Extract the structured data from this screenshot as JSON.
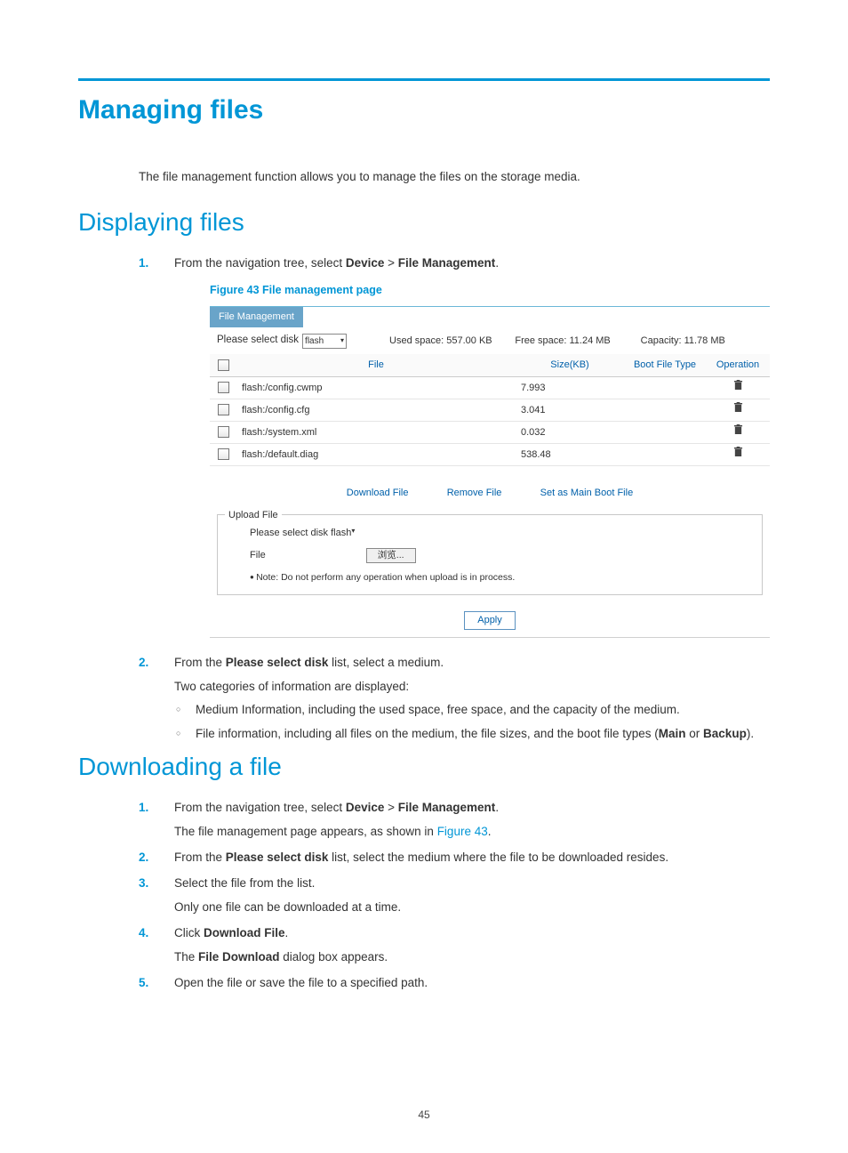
{
  "h1": "Managing files",
  "intro": "The file management function allows you to manage the files on the storage media.",
  "h2_display": "Displaying files",
  "h2_download": "Downloading a file",
  "figcap": "Figure 43 File management page",
  "nav_step": {
    "pre": "From the navigation tree, select ",
    "device": "Device",
    "gt": " > ",
    "fm": "File Management",
    "post": "."
  },
  "ss": {
    "tab": "File Management",
    "select_label": "Please select disk",
    "select_value": "flash",
    "used": "Used space: 557.00 KB",
    "free": "Free space: 11.24 MB",
    "cap": "Capacity: 11.78 MB",
    "cols": {
      "file": "File",
      "size": "Size(KB)",
      "boot": "Boot File Type",
      "op": "Operation"
    },
    "rows": [
      {
        "name": "flash:/config.cwmp",
        "size": "7.993"
      },
      {
        "name": "flash:/config.cfg",
        "size": "3.041"
      },
      {
        "name": "flash:/system.xml",
        "size": "0.032"
      },
      {
        "name": "flash:/default.diag",
        "size": "538.48"
      }
    ],
    "actions": {
      "download": "Download File",
      "remove": "Remove File",
      "setmain": "Set as Main Boot File"
    },
    "upload": {
      "legend": "Upload File",
      "select_label": "Please select disk",
      "select_value": "flash",
      "file_label": "File",
      "browse": "浏览...",
      "note": "Note: Do not perform any operation when upload is in process."
    },
    "apply": "Apply"
  },
  "disp_step2": {
    "pre": "From the ",
    "b": "Please select disk",
    "post": " list, select a medium.",
    "sub": "Two categories of information are displayed:",
    "b1": "Medium Information, including the used space, free space, and the capacity of the medium.",
    "b2_pre": "File information, including all files on the medium, the file sizes, and the boot file types (",
    "b2_main": "Main",
    "b2_or": " or ",
    "b2_backup": "Backup",
    "b2_post": ")."
  },
  "dl": {
    "s1_sub_pre": "The file management page appears, as shown in ",
    "s1_sub_link": "Figure 43",
    "s1_sub_post": ".",
    "s2_pre": "From the ",
    "s2_b": "Please select disk",
    "s2_post": " list, select the medium where the file to be downloaded resides.",
    "s3": "Select the file from the list.",
    "s3_sub": "Only one file can be downloaded at a time.",
    "s4_pre": "Click ",
    "s4_b": "Download File",
    "s4_post": ".",
    "s4_sub_pre": "The ",
    "s4_sub_b": "File Download",
    "s4_sub_post": " dialog box appears.",
    "s5": "Open the file or save the file to a specified path."
  },
  "page_no": "45"
}
